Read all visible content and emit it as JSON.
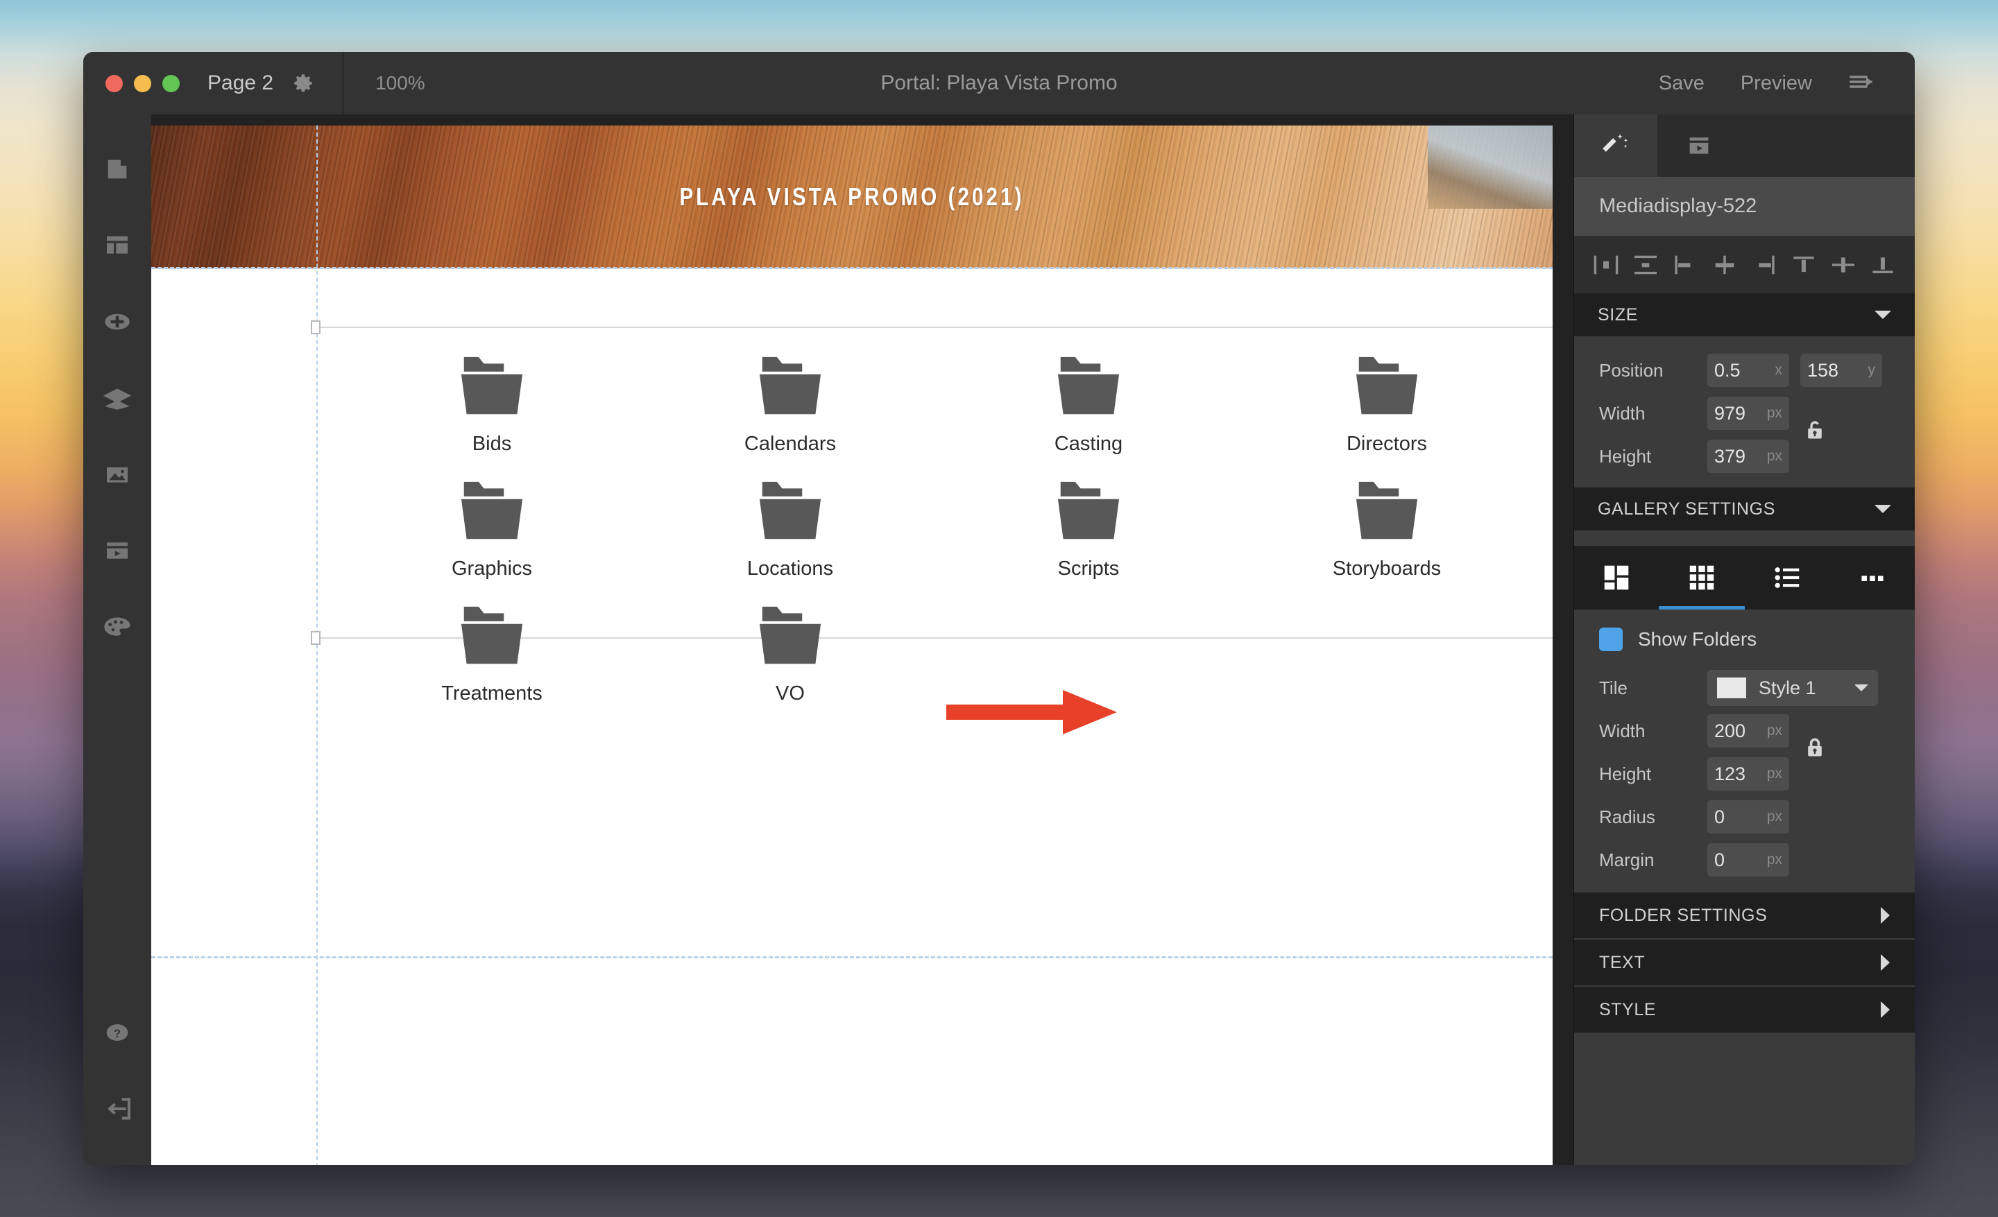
{
  "titlebar": {
    "page_name": "Page 2",
    "gear_icon": "gear-icon",
    "zoom_level": "100%",
    "document_title": "Portal: Playa Vista Promo",
    "save_label": "Save",
    "preview_label": "Preview",
    "panel_toggle_icon": "arrow-right-lines-icon"
  },
  "left_rail": {
    "items": [
      {
        "icon": "page-icon"
      },
      {
        "icon": "layout-template-icon"
      },
      {
        "icon": "add-circle-icon"
      },
      {
        "icon": "layers-icon"
      },
      {
        "icon": "image-icon"
      },
      {
        "icon": "media-player-icon"
      },
      {
        "icon": "palette-icon"
      }
    ],
    "bottom_items": [
      {
        "icon": "help-circle-icon"
      },
      {
        "icon": "logout-icon"
      }
    ]
  },
  "canvas": {
    "hero_title": "PLAYA VISTA PROMO (2021)",
    "folders": [
      "Bids",
      "Calendars",
      "Casting",
      "Directors",
      "Graphics",
      "Locations",
      "Scripts",
      "Storyboards",
      "Treatments",
      "VO"
    ],
    "folder_icon": "folder-icon",
    "annotation_arrow": {
      "icon": "red-arrow-right",
      "color": "#e8412a"
    }
  },
  "inspector": {
    "tabs": [
      {
        "icon": "magic-wand-icon",
        "active": true
      },
      {
        "icon": "media-player-icon",
        "active": false
      }
    ],
    "element_name": "Mediadisplay-522",
    "align_buttons": [
      {
        "icon": "align-horizontal-distribute-icon"
      },
      {
        "icon": "align-vertical-distribute-icon"
      },
      {
        "icon": "align-left-icon"
      },
      {
        "icon": "align-center-horizontal-icon"
      },
      {
        "icon": "align-right-icon"
      },
      {
        "icon": "align-top-icon"
      },
      {
        "icon": "align-middle-vertical-icon"
      },
      {
        "icon": "align-bottom-icon"
      }
    ],
    "size": {
      "header": "SIZE",
      "position_label": "Position",
      "position_x": "0.5",
      "position_x_unit": "x",
      "position_y": "158",
      "position_y_unit": "y",
      "width_label": "Width",
      "width_value": "979",
      "width_unit": "px",
      "height_label": "Height",
      "height_value": "379",
      "height_unit": "px",
      "lock_icon": "unlocked-icon"
    },
    "gallery": {
      "header": "GALLERY SETTINGS",
      "view_tabs": [
        {
          "icon": "masonry-view-icon",
          "active": false
        },
        {
          "icon": "grid-view-icon",
          "active": true
        },
        {
          "icon": "list-view-icon",
          "active": false
        },
        {
          "icon": "more-options-icon",
          "active": false
        }
      ],
      "show_folders_label": "Show Folders",
      "show_folders_checked": true,
      "checkbox_color": "#4fa3e8",
      "tile_label": "Tile",
      "tile_value": "Style 1",
      "width_label": "Width",
      "width_value": "200",
      "width_unit": "px",
      "height_label": "Height",
      "height_value": "123",
      "height_unit": "px",
      "radius_label": "Radius",
      "radius_value": "0",
      "radius_unit": "px",
      "margin_label": "Margin",
      "margin_value": "0",
      "margin_unit": "px",
      "lock_icon": "locked-icon"
    },
    "collapsed_sections": [
      {
        "label": "FOLDER SETTINGS"
      },
      {
        "label": "TEXT"
      },
      {
        "label": "STYLE"
      }
    ]
  }
}
